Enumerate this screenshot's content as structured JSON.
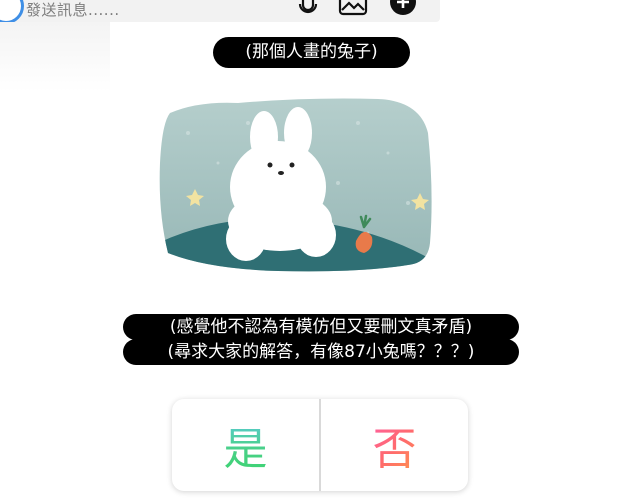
{
  "composer": {
    "placeholder": "發送訊息......",
    "icons": [
      "microphone-icon",
      "image-icon",
      "plus-icon"
    ]
  },
  "captions": {
    "top": "(那個人畫的兔子)",
    "line1": "(感覺他不認為有模仿但又要刪文真矛盾)",
    "line2": "(尋求大家的解答，有像87小兔嗎？？？)"
  },
  "poll": {
    "yes_label": "是",
    "no_label": "否"
  },
  "colors": {
    "avatar_ring": "#3f8fe6",
    "sky": "#a9c4c3",
    "hill": "#2f6f74",
    "yes_gradient": [
      "#5dc9e6",
      "#3bd36c"
    ],
    "no_gradient": [
      "#ff5ea8",
      "#ff9b4a"
    ]
  }
}
